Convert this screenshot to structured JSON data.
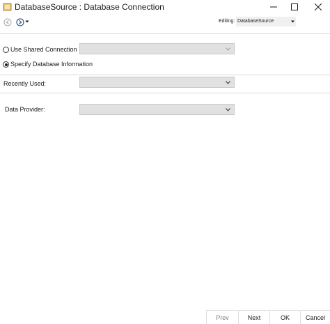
{
  "window": {
    "title": "DatabaseSource : Database Connection"
  },
  "toolbar": {
    "editing_label": "Editing:",
    "editing_value": "DatabaseSource"
  },
  "connection": {
    "use_shared_label": "Use Shared Connection",
    "use_shared_selected": false,
    "specify_label": "Specify Database Information",
    "specify_selected": true
  },
  "recently_used": {
    "label": "Recently Used:",
    "value": ""
  },
  "data_provider": {
    "label": "Data Provider:",
    "value": ""
  },
  "buttons": {
    "prev": "Prev",
    "next": "Next",
    "ok": "OK",
    "cancel": "Cancel"
  }
}
